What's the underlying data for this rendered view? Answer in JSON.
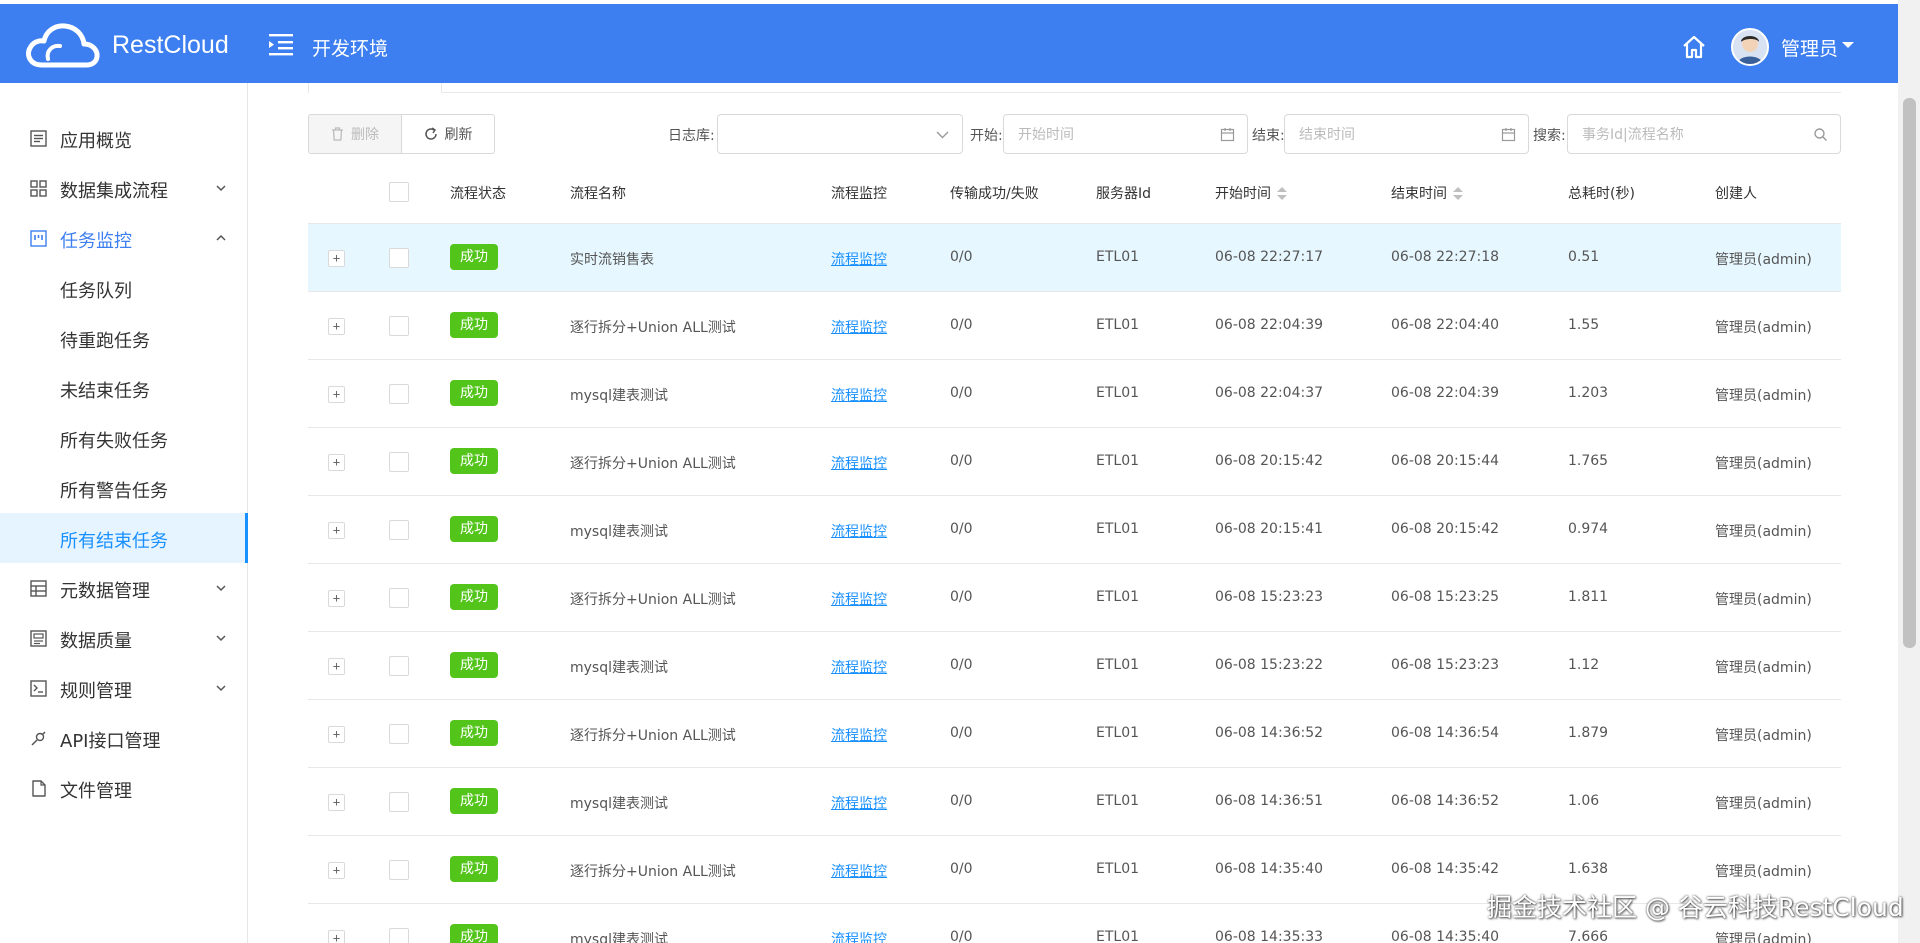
{
  "header": {
    "brand": "RestCloud",
    "env": "开发环境",
    "user": "管理员",
    "colors": {
      "primary": "#3d7ff0",
      "success": "#52c41a",
      "link": "#1890ff"
    }
  },
  "sidebar": {
    "items": [
      {
        "label": "应用概览",
        "icon": "list-icon"
      },
      {
        "label": "数据集成流程",
        "icon": "grid-icon"
      },
      {
        "label": "任务监控",
        "icon": "monitor-icon"
      },
      {
        "label": "任务队列"
      },
      {
        "label": "待重跑任务"
      },
      {
        "label": "未结束任务"
      },
      {
        "label": "所有失败任务"
      },
      {
        "label": "所有警告任务"
      },
      {
        "label": "所有结束任务"
      },
      {
        "label": "元数据管理",
        "icon": "table-icon"
      },
      {
        "label": "数据质量",
        "icon": "image-icon"
      },
      {
        "label": "规则管理",
        "icon": "terminal-icon"
      },
      {
        "label": "API接口管理",
        "icon": "api-icon"
      },
      {
        "label": "文件管理",
        "icon": "file-icon"
      }
    ],
    "active": "所有结束任务"
  },
  "toolbar": {
    "delete_label": "删除",
    "refresh_label": "刷新",
    "log_db_label": "日志库:",
    "start_label": "开始:",
    "start_placeholder": "开始时间",
    "end_label": "结束:",
    "end_placeholder": "结束时间",
    "search_label": "搜索:",
    "search_placeholder": "事务Id|流程名称"
  },
  "table": {
    "columns": {
      "status": "流程状态",
      "name": "流程名称",
      "monitor": "流程监控",
      "transfer": "传输成功/失败",
      "server": "服务器Id",
      "start": "开始时间",
      "end": "结束时间",
      "duration": "总耗时(秒)",
      "creator": "创建人"
    },
    "rows": [
      {
        "expand": "+",
        "status": "成功",
        "name": "实时流销售表",
        "monitor": "流程监控",
        "transfer": "0/0",
        "server": "ETL01",
        "start": "06-08 22:27:17",
        "end": "06-08 22:27:18",
        "duration": "0.51",
        "creator": "管理员(admin)"
      },
      {
        "expand": "+",
        "status": "成功",
        "name": "逐行拆分+Union ALL测试",
        "monitor": "流程监控",
        "transfer": "0/0",
        "server": "ETL01",
        "start": "06-08 22:04:39",
        "end": "06-08 22:04:40",
        "duration": "1.55",
        "creator": "管理员(admin)"
      },
      {
        "expand": "+",
        "status": "成功",
        "name": "mysql建表测试",
        "monitor": "流程监控",
        "transfer": "0/0",
        "server": "ETL01",
        "start": "06-08 22:04:37",
        "end": "06-08 22:04:39",
        "duration": "1.203",
        "creator": "管理员(admin)"
      },
      {
        "expand": "+",
        "status": "成功",
        "name": "逐行拆分+Union ALL测试",
        "monitor": "流程监控",
        "transfer": "0/0",
        "server": "ETL01",
        "start": "06-08 20:15:42",
        "end": "06-08 20:15:44",
        "duration": "1.765",
        "creator": "管理员(admin)"
      },
      {
        "expand": "+",
        "status": "成功",
        "name": "mysql建表测试",
        "monitor": "流程监控",
        "transfer": "0/0",
        "server": "ETL01",
        "start": "06-08 20:15:41",
        "end": "06-08 20:15:42",
        "duration": "0.974",
        "creator": "管理员(admin)"
      },
      {
        "expand": "+",
        "status": "成功",
        "name": "逐行拆分+Union ALL测试",
        "monitor": "流程监控",
        "transfer": "0/0",
        "server": "ETL01",
        "start": "06-08 15:23:23",
        "end": "06-08 15:23:25",
        "duration": "1.811",
        "creator": "管理员(admin)"
      },
      {
        "expand": "+",
        "status": "成功",
        "name": "mysql建表测试",
        "monitor": "流程监控",
        "transfer": "0/0",
        "server": "ETL01",
        "start": "06-08 15:23:22",
        "end": "06-08 15:23:23",
        "duration": "1.12",
        "creator": "管理员(admin)"
      },
      {
        "expand": "+",
        "status": "成功",
        "name": "逐行拆分+Union ALL测试",
        "monitor": "流程监控",
        "transfer": "0/0",
        "server": "ETL01",
        "start": "06-08 14:36:52",
        "end": "06-08 14:36:54",
        "duration": "1.879",
        "creator": "管理员(admin)"
      },
      {
        "expand": "+",
        "status": "成功",
        "name": "mysql建表测试",
        "monitor": "流程监控",
        "transfer": "0/0",
        "server": "ETL01",
        "start": "06-08 14:36:51",
        "end": "06-08 14:36:52",
        "duration": "1.06",
        "creator": "管理员(admin)"
      },
      {
        "expand": "+",
        "status": "成功",
        "name": "逐行拆分+Union ALL测试",
        "monitor": "流程监控",
        "transfer": "0/0",
        "server": "ETL01",
        "start": "06-08 14:35:40",
        "end": "06-08 14:35:42",
        "duration": "1.638",
        "creator": "管理员(admin)"
      },
      {
        "expand": "+",
        "status": "成功",
        "name": "mysql建表测试",
        "monitor": "流程监控",
        "transfer": "0/0",
        "server": "ETL01",
        "start": "06-08 14:35:33",
        "end": "06-08 14:35:40",
        "duration": "7.666",
        "creator": "管理员(admin)"
      }
    ]
  },
  "watermark": "掘金技术社区 @ 谷云科技RestCloud"
}
